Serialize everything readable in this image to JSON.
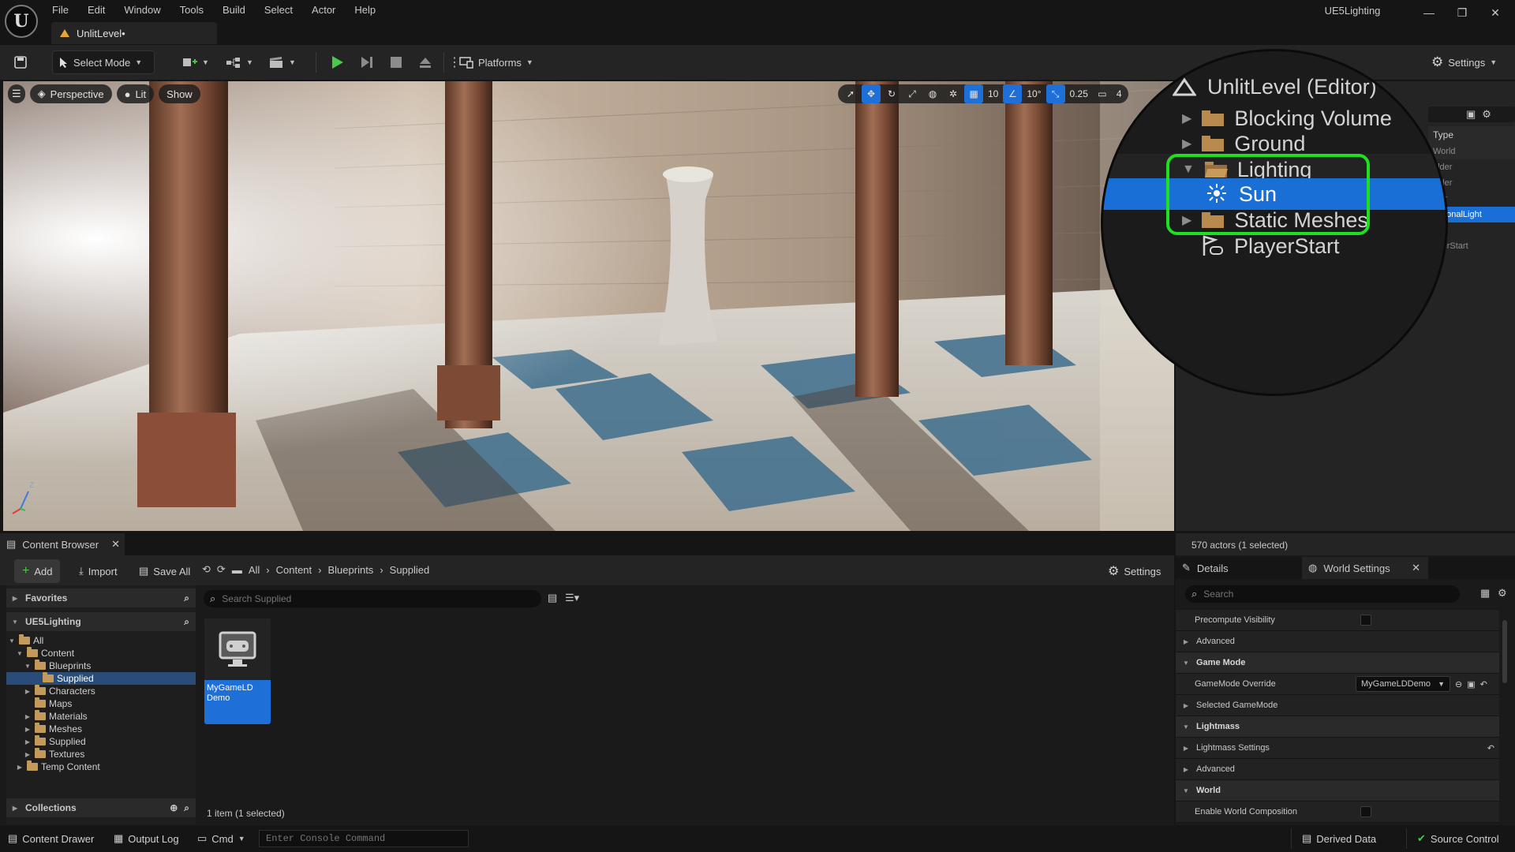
{
  "titlebar": {
    "menu": [
      "File",
      "Edit",
      "Window",
      "Tools",
      "Build",
      "Select",
      "Actor",
      "Help"
    ],
    "level_tab": "UnlitLevel•",
    "project_name": "UE5Lighting",
    "window_controls": [
      "—",
      "❐",
      "✕"
    ]
  },
  "toolbar": {
    "select_mode": "Select Mode",
    "platforms": "Platforms",
    "settings": "Settings"
  },
  "viewport": {
    "perspective": "Perspective",
    "lit": "Lit",
    "show": "Show",
    "grid_snap": "10",
    "rotation_snap": "10°",
    "scale_snap": "0.25",
    "camera_speed": "4",
    "axis_z": "Z"
  },
  "outliner": {
    "type_header": "Type",
    "type_values": [
      "World",
      "older",
      "older",
      "lder",
      "ectionalLight",
      "lder",
      "ayerStart"
    ],
    "zoom_items": [
      {
        "label": "UnlitLevel (Editor)",
        "kind": "level"
      },
      {
        "label": "Blocking Volume",
        "kind": "folder"
      },
      {
        "label": "Ground",
        "kind": "folder"
      },
      {
        "label": "Lighting",
        "kind": "folder-open"
      },
      {
        "label": "Sun",
        "kind": "light",
        "selected": true
      },
      {
        "label": "Static Meshes",
        "kind": "folder"
      },
      {
        "label": "PlayerStart",
        "kind": "playerstart"
      }
    ],
    "actor_count": "570 actors (1 selected)"
  },
  "content_browser": {
    "tab_title": "Content Browser",
    "add": "Add",
    "import": "Import",
    "save_all": "Save All",
    "breadcrumb": [
      "All",
      "Content",
      "Blueprints",
      "Supplied"
    ],
    "settings": "Settings",
    "favorites": "Favorites",
    "project": "UE5Lighting",
    "collections": "Collections",
    "search_placeholder": "Search Supplied",
    "tree": [
      {
        "label": "All",
        "depth": 0,
        "open": true
      },
      {
        "label": "Content",
        "depth": 1,
        "open": true
      },
      {
        "label": "Blueprints",
        "depth": 2,
        "open": true
      },
      {
        "label": "Supplied",
        "depth": 3,
        "selected": true
      },
      {
        "label": "Characters",
        "depth": 2,
        "closed": true
      },
      {
        "label": "Maps",
        "depth": 2
      },
      {
        "label": "Materials",
        "depth": 2,
        "closed": true
      },
      {
        "label": "Meshes",
        "depth": 2,
        "closed": true
      },
      {
        "label": "Supplied",
        "depth": 2,
        "closed": true
      },
      {
        "label": "Textures",
        "depth": 2,
        "closed": true
      },
      {
        "label": "Temp Content",
        "depth": 1,
        "closed": true
      }
    ],
    "asset": {
      "line1": "MyGameLD",
      "line2": "Demo"
    },
    "status": "1 item (1 selected)"
  },
  "details": {
    "tab_details": "Details",
    "tab_world_settings": "World Settings",
    "search_placeholder": "Search",
    "rows": [
      {
        "label": "Precompute Visibility",
        "type": "check"
      },
      {
        "label": "Advanced",
        "type": "sub"
      },
      {
        "label": "Game Mode",
        "type": "cat"
      },
      {
        "label": "GameMode Override",
        "type": "dropdown",
        "value": "MyGameLDDemo"
      },
      {
        "label": "Selected GameMode",
        "type": "sub"
      },
      {
        "label": "Lightmass",
        "type": "cat"
      },
      {
        "label": "Lightmass Settings",
        "type": "sub-reset"
      },
      {
        "label": "Advanced",
        "type": "sub"
      },
      {
        "label": "World",
        "type": "cat"
      },
      {
        "label": "Enable World Composition",
        "type": "check"
      }
    ]
  },
  "statusbar": {
    "content_drawer": "Content Drawer",
    "output_log": "Output Log",
    "cmd": "Cmd",
    "console_placeholder": "Enter Console Command",
    "derived_data": "Derived Data",
    "source_control": "Source Control"
  }
}
